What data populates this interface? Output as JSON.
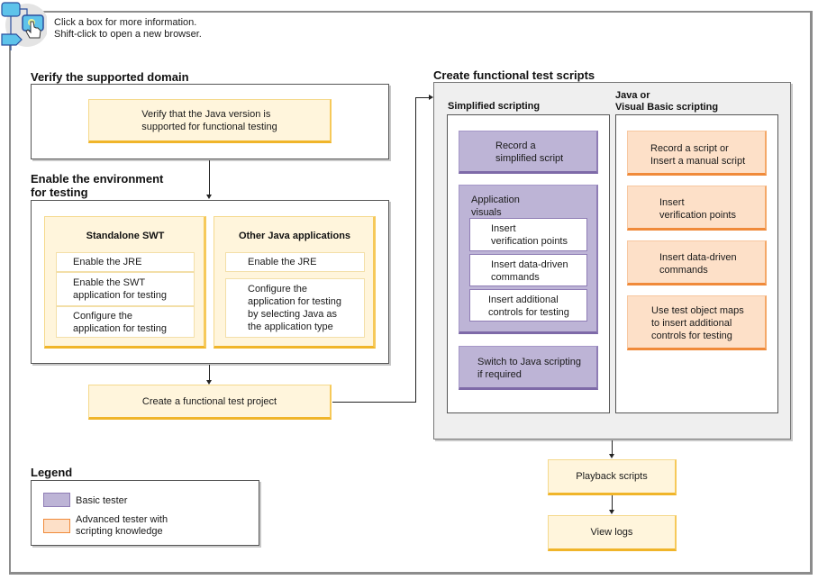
{
  "header": {
    "icon": "flowchart-click-icon",
    "line1": "Click a box for more information.",
    "line2": "Shift-click to open a new browser."
  },
  "colors": {
    "step_yellow": "#fff5dc",
    "step_yellow_border": "#f0b52a",
    "basic_tester_purple": "#bdb4d6",
    "advanced_tester_orange": "#fde0c8",
    "container_grey": "#efefef"
  },
  "verify_domain": {
    "title": "Verify the supported domain",
    "step": {
      "line1": "Verify that the Java version is",
      "line2": "supported for functional testing"
    }
  },
  "enable_env": {
    "title_line1": "Enable the environment",
    "title_line2": "for testing",
    "standalone_swt": {
      "title": "Standalone SWT",
      "items": [
        {
          "line1": "Enable the JRE",
          "line2": ""
        },
        {
          "line1": "Enable the SWT",
          "line2": "application for testing"
        },
        {
          "line1": "Configure the",
          "line2": "application for testing"
        }
      ]
    },
    "other_java": {
      "title": "Other Java applications",
      "items": [
        {
          "lines": [
            "Enable the JRE"
          ]
        },
        {
          "lines": [
            "Configure the",
            "application for testing",
            "by selecting Java as",
            "the application type"
          ]
        }
      ]
    }
  },
  "create_project": {
    "label": "Create a functional test project"
  },
  "scripts": {
    "title": "Create functional test scripts",
    "simplified": {
      "title": "Simplified scripting",
      "record": {
        "line1": "Record a",
        "line2": "simplified script"
      },
      "app_visuals": {
        "title_line1": "Application",
        "title_line2": "visuals",
        "items": [
          {
            "line1": "Insert",
            "line2": "verification points"
          },
          {
            "line1": "Insert data-driven",
            "line2": "commands"
          },
          {
            "line1": "Insert additional",
            "line2": "controls for testing"
          }
        ]
      },
      "switch": {
        "line1": "Switch to Java scripting",
        "line2": "if required"
      }
    },
    "java_vb": {
      "title_line1": "Java or",
      "title_line2": "Visual Basic scripting",
      "items": [
        {
          "lines": [
            "Record a script or",
            "Insert a manual script"
          ]
        },
        {
          "lines": [
            "Insert",
            "verification points"
          ]
        },
        {
          "lines": [
            "Insert data-driven",
            "commands"
          ]
        },
        {
          "lines": [
            "Use test object maps",
            "to insert additional",
            "controls for testing"
          ]
        }
      ]
    }
  },
  "playback": {
    "label": "Playback scripts"
  },
  "view_logs": {
    "label": "View logs"
  },
  "legend": {
    "title": "Legend",
    "items": [
      {
        "label_line1": "Basic tester",
        "label_line2": "",
        "color": "#bdb4d6"
      },
      {
        "label_line1": "Advanced tester with",
        "label_line2": "scripting knowledge",
        "color": "#fde0c8"
      }
    ]
  }
}
